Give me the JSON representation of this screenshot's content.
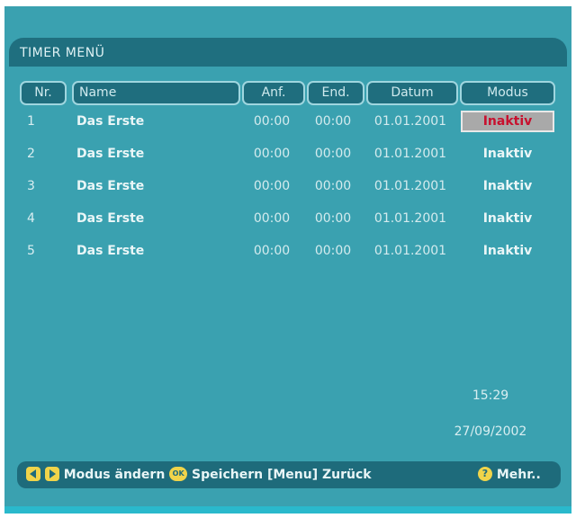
{
  "title": "TIMER MENÜ",
  "columns": {
    "nr": "Nr.",
    "name": "Name",
    "anf": "Anf.",
    "end": "End.",
    "datum": "Datum",
    "modus": "Modus"
  },
  "rows": [
    {
      "nr": "1",
      "name": "Das Erste",
      "anf": "00:00",
      "end": "00:00",
      "datum": "01.01.2001",
      "modus": "Inaktiv",
      "selected": true
    },
    {
      "nr": "2",
      "name": "Das Erste",
      "anf": "00:00",
      "end": "00:00",
      "datum": "01.01.2001",
      "modus": "Inaktiv",
      "selected": false
    },
    {
      "nr": "3",
      "name": "Das Erste",
      "anf": "00:00",
      "end": "00:00",
      "datum": "01.01.2001",
      "modus": "Inaktiv",
      "selected": false
    },
    {
      "nr": "4",
      "name": "Das Erste",
      "anf": "00:00",
      "end": "00:00",
      "datum": "01.01.2001",
      "modus": "Inaktiv",
      "selected": false
    },
    {
      "nr": "5",
      "name": "Das Erste",
      "anf": "00:00",
      "end": "00:00",
      "datum": "01.01.2001",
      "modus": "Inaktiv",
      "selected": false
    }
  ],
  "clock": {
    "time": "15:29",
    "date": "27/09/2002"
  },
  "footer": {
    "change_mode": "Modus ändern",
    "ok_key": "OK",
    "save": "Speichern",
    "back": "[Menu] Zurück",
    "help_key": "?",
    "more": "Mehr.."
  },
  "icons": {
    "left_arrow": "left-arrow-key-icon",
    "right_arrow": "right-arrow-key-icon",
    "ok": "ok-key-icon",
    "help": "help-key-icon"
  },
  "colors": {
    "background": "#3aa1b0",
    "panel": "#1f6f7f",
    "key_yellow": "#f0d44a",
    "selected_text": "#c8102e",
    "selected_bg": "#a9a9a9"
  }
}
